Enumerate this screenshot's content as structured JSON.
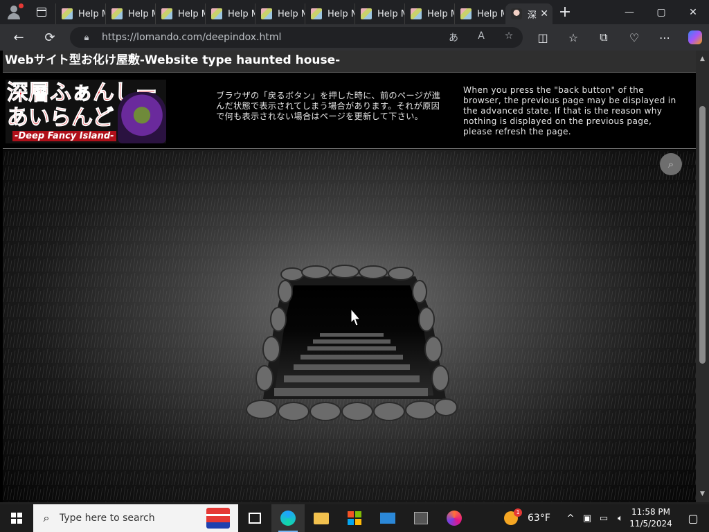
{
  "browser": {
    "tabs": [
      {
        "label": "Help M"
      },
      {
        "label": "Help M"
      },
      {
        "label": "Help M"
      },
      {
        "label": "Help M"
      },
      {
        "label": "Help M"
      },
      {
        "label": "Help M"
      },
      {
        "label": "Help M"
      },
      {
        "label": "Help M"
      },
      {
        "label": "Help M"
      },
      {
        "label": "深",
        "active": true
      }
    ],
    "address_url": "https://lomando.com/deepindox.html",
    "window_controls": {
      "minimize": "—",
      "maximize": "▢",
      "close": "✕"
    }
  },
  "page": {
    "title": "Webサイト型お化け屋敷-Website type haunted house-",
    "logo": {
      "line1_red": "深層",
      "line1_rest": "ふぁんしー",
      "line2": "あいらんど",
      "line3": "-Deep Fancy Island-"
    },
    "notice_ja": "ブラウザの「戻るボタン」を押した時に、前のページが進んだ状態で表示されてしまう場合があります。それが原因で何も表示されない場合はページを更新して下さい。",
    "notice_en": "When you press the \"back button\" of the browser, the previous page may be displayed in the advanced state. If that is the reason why nothing is displayed on the previous page, please refresh the page."
  },
  "taskbar": {
    "search_placeholder": "Type here to search",
    "weather_temp": "63°F",
    "time": "11:58 PM",
    "date": "11/5/2024"
  }
}
